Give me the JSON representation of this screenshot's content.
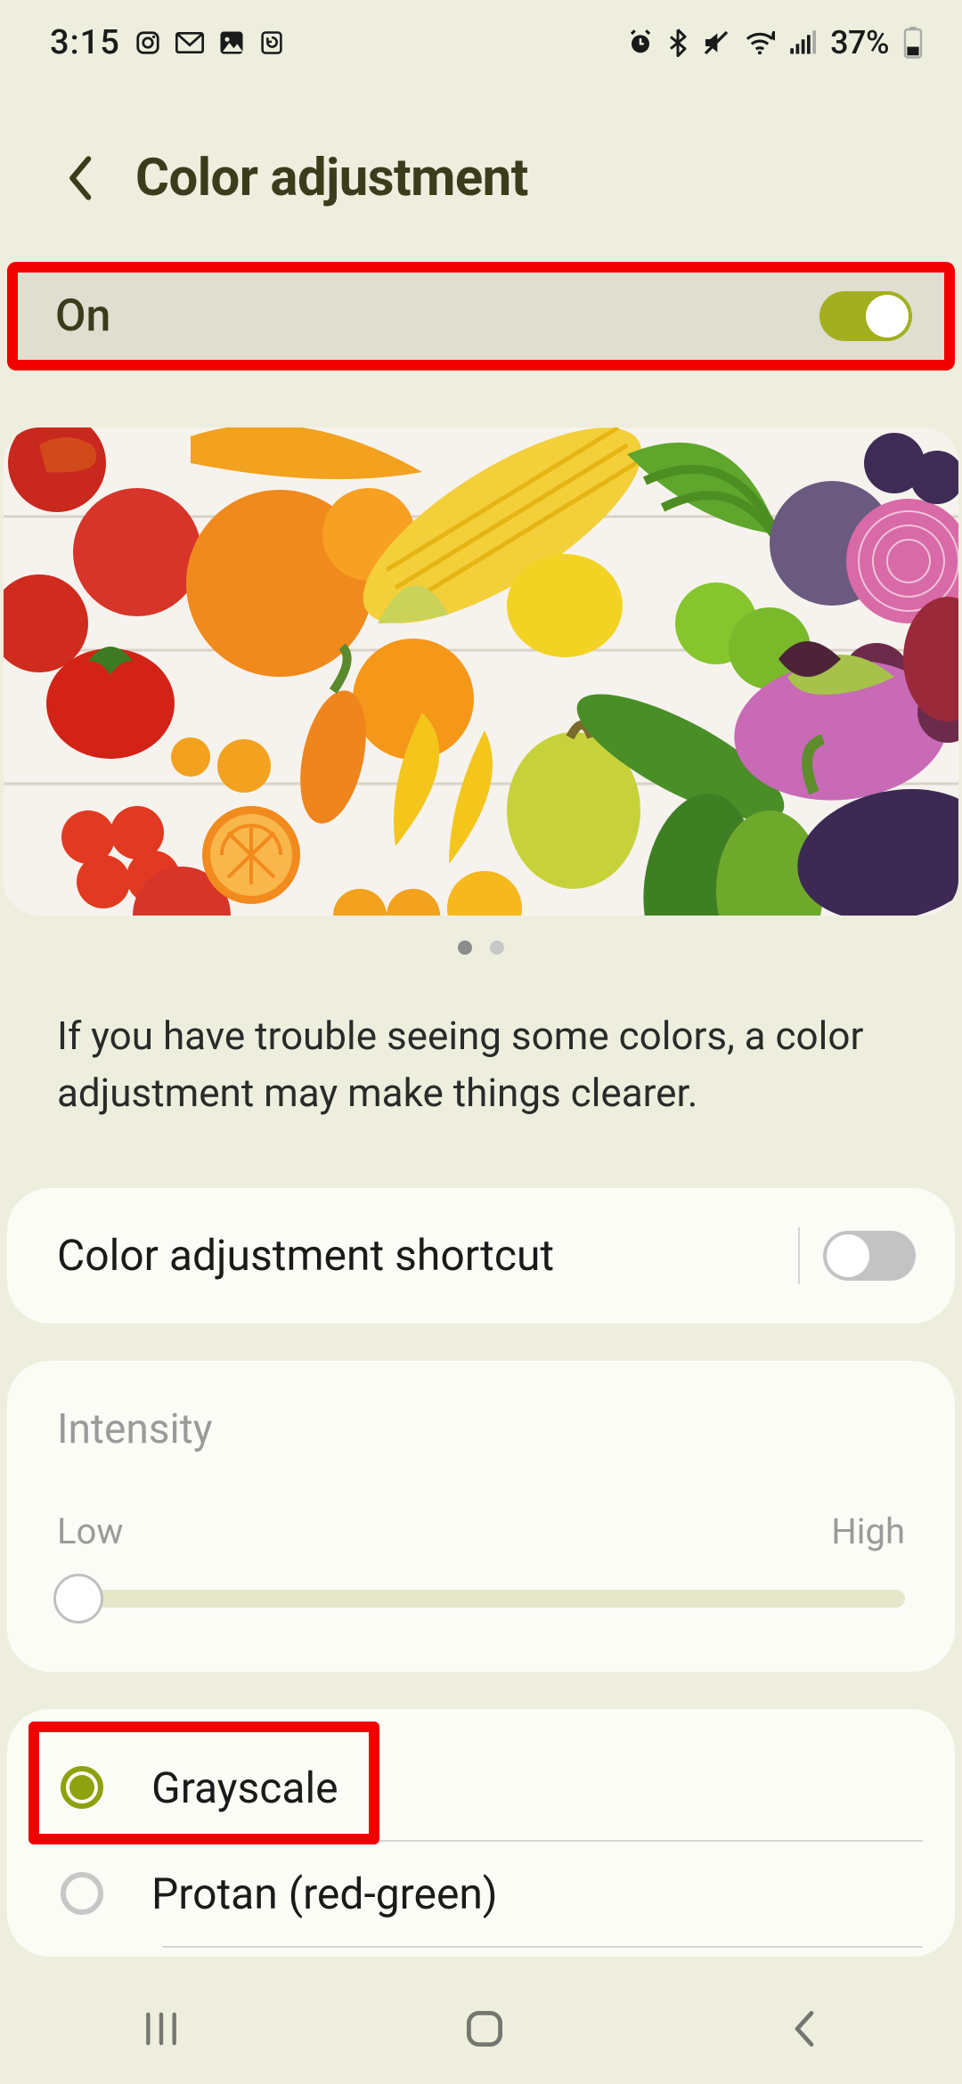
{
  "status": {
    "time": "3:15",
    "battery": "37%"
  },
  "header": {
    "title": "Color adjustment"
  },
  "master": {
    "label": "On"
  },
  "description": "If you have trouble seeing some colors, a color adjustment may make things clearer.",
  "shortcut": {
    "label": "Color adjustment shortcut"
  },
  "intensity": {
    "heading": "Intensity",
    "low": "Low",
    "high": "High"
  },
  "modes": {
    "items": [
      {
        "label": "Grayscale"
      },
      {
        "label": "Protan (red-green)"
      }
    ]
  }
}
